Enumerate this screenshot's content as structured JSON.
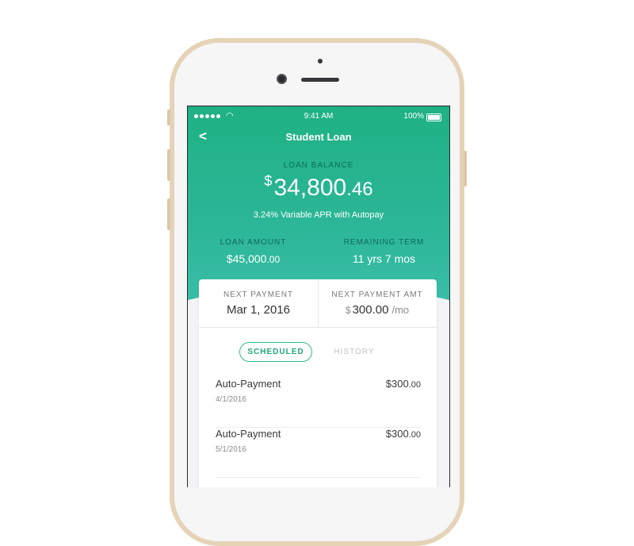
{
  "status_bar": {
    "time": "9:41 AM",
    "battery": "100%"
  },
  "nav": {
    "back": "<",
    "title": "Student Loan"
  },
  "balance": {
    "label": "LOAN BALANCE",
    "currency": "$",
    "amount_main": "34,800",
    "amount_cents": ".46",
    "apr": "3.24% Variable APR with Autopay"
  },
  "loan_amount": {
    "label": "LOAN AMOUNT",
    "value_main": "$45,000",
    "value_cents": ".00"
  },
  "remaining_term": {
    "label": "REMAINING TERM",
    "value": "11 yrs 7 mos"
  },
  "next_payment": {
    "label": "NEXT PAYMENT",
    "value": "Mar 1, 2016"
  },
  "next_payment_amt": {
    "label": "NEXT PAYMENT AMT",
    "currency": "$",
    "value": "300.00",
    "period": "/mo"
  },
  "tabs": {
    "scheduled": "SCHEDULED",
    "history": "HISTORY"
  },
  "payments": [
    {
      "title": "Auto-Payment",
      "date": "4/1/2016",
      "amount_main": "$300",
      "amount_cents": ".00"
    },
    {
      "title": "Auto-Payment",
      "date": "5/1/2016",
      "amount_main": "$300",
      "amount_cents": ".00"
    }
  ],
  "colors": {
    "accent": "#1fb183",
    "phone_gold": "#e6d3b6"
  }
}
